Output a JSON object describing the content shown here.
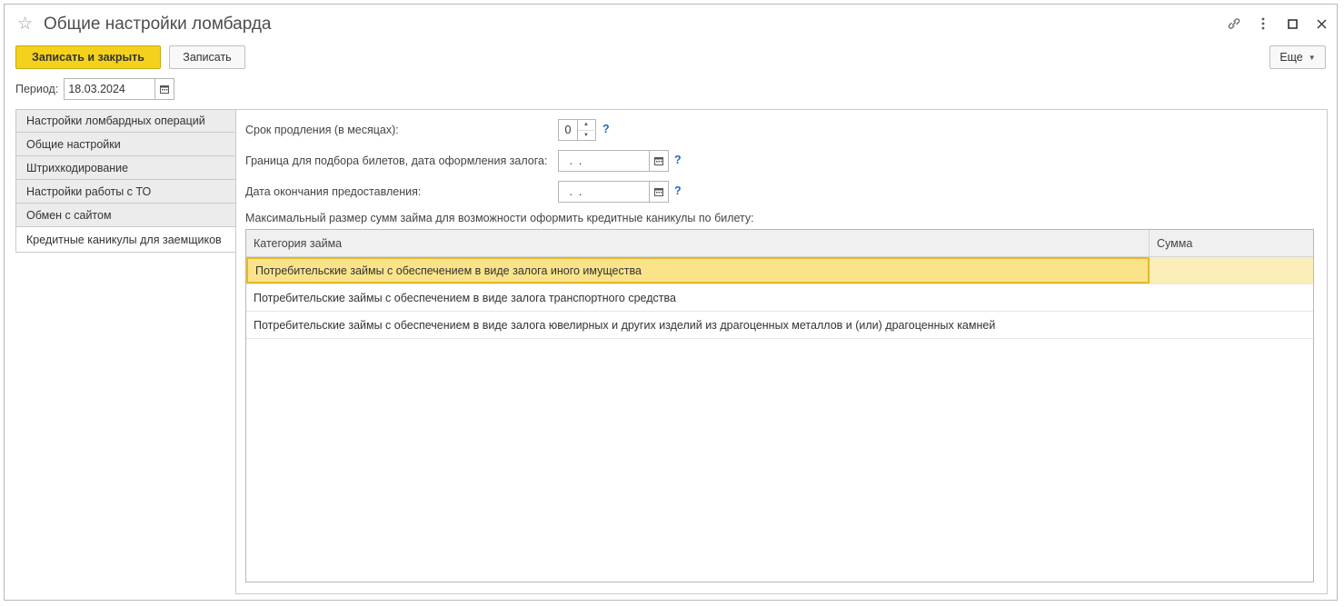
{
  "window": {
    "title": "Общие настройки ломбарда",
    "controls": [
      "link-icon",
      "more-vert-icon",
      "maximize-icon",
      "close-icon"
    ]
  },
  "toolbar": {
    "save_close_label": "Записать и закрыть",
    "save_label": "Записать",
    "more_label": "Еще"
  },
  "period": {
    "label": "Период:",
    "value": "18.03.2024"
  },
  "tabs": [
    {
      "label": "Настройки ломбардных операций",
      "active": false
    },
    {
      "label": "Общие настройки",
      "active": false
    },
    {
      "label": "Штрихкодирование",
      "active": false
    },
    {
      "label": "Настройки работы с ТО",
      "active": false
    },
    {
      "label": "Обмен с сайтом",
      "active": false
    },
    {
      "label": "Кредитные каникулы для заемщиков",
      "active": true
    }
  ],
  "form": {
    "extension_label": "Срок продления (в месяцах):",
    "extension_value": "0",
    "border_label": "Граница для подбора билетов, дата оформления залога:",
    "border_value": " .  .",
    "end_date_label": "Дата окончания предоставления:",
    "end_date_value": " .  .",
    "help": "?",
    "section_label": "Максимальный размер сумм займа для возможности оформить кредитные каникулы по билету:"
  },
  "grid": {
    "columns": [
      "Категория займа",
      "Сумма"
    ],
    "rows": [
      {
        "category": "Потребительские займы с обеспечением в виде залога иного имущества",
        "sum": "",
        "selected": true
      },
      {
        "category": "Потребительские займы с обеспечением в виде залога транспортного средства",
        "sum": "",
        "selected": false
      },
      {
        "category": "Потребительские займы с обеспечением в виде залога ювелирных и других изделий из драгоценных металлов и (или) драгоценных камней",
        "sum": "",
        "selected": false
      }
    ]
  },
  "colors": {
    "primary_button": "#f4d21c",
    "selected_row": "#fbe38a",
    "help_link": "#1e6bb8"
  }
}
